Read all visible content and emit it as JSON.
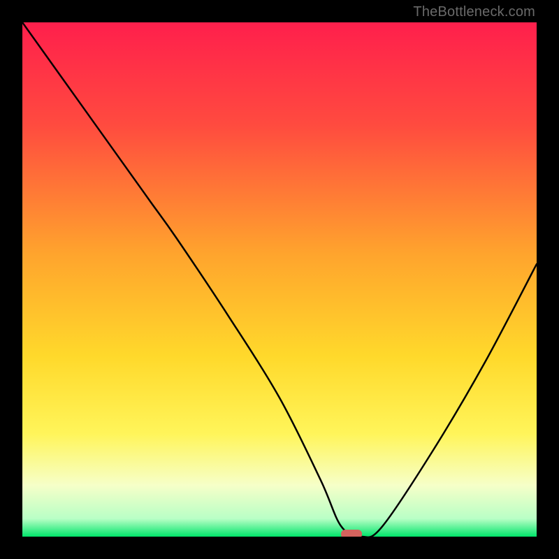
{
  "watermark": "TheBottleneck.com",
  "chart_data": {
    "type": "line",
    "title": "",
    "xlabel": "",
    "ylabel": "",
    "xlim": [
      0,
      100
    ],
    "ylim": [
      0,
      100
    ],
    "grid": false,
    "series": [
      {
        "name": "bottleneck-curve",
        "x": [
          0,
          10,
          20,
          25,
          30,
          40,
          50,
          58,
          62,
          66,
          70,
          80,
          90,
          100
        ],
        "y": [
          100,
          86,
          72,
          65,
          58,
          43,
          27,
          11,
          2,
          0,
          2,
          17,
          34,
          53
        ]
      }
    ],
    "marker": {
      "x": 64,
      "y": 0,
      "color": "#d4635e"
    },
    "gradient_stops": [
      {
        "pos": 0.0,
        "color": "#ff1f4c"
      },
      {
        "pos": 0.2,
        "color": "#ff4b3f"
      },
      {
        "pos": 0.45,
        "color": "#ffa42d"
      },
      {
        "pos": 0.65,
        "color": "#ffd92b"
      },
      {
        "pos": 0.8,
        "color": "#fff55a"
      },
      {
        "pos": 0.9,
        "color": "#f6ffc8"
      },
      {
        "pos": 0.965,
        "color": "#b9ffc6"
      },
      {
        "pos": 1.0,
        "color": "#00e56a"
      }
    ]
  }
}
